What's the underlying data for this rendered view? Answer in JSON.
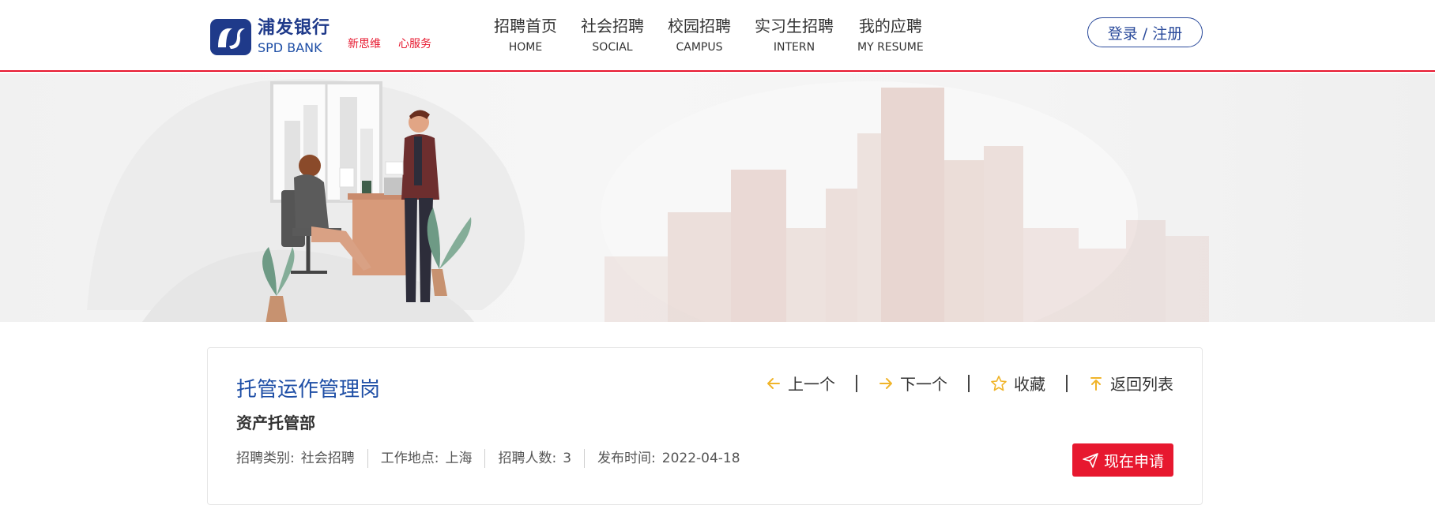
{
  "brand": {
    "name_cn": "浦发银行",
    "name_en": "SPD BANK",
    "slogans": [
      "新思维",
      "心服务"
    ]
  },
  "nav": [
    {
      "cn": "招聘首页",
      "en": "HOME"
    },
    {
      "cn": "社会招聘",
      "en": "SOCIAL"
    },
    {
      "cn": "校园招聘",
      "en": "CAMPUS"
    },
    {
      "cn": "实习生招聘",
      "en": "INTERN"
    },
    {
      "cn": "我的应聘",
      "en": "MY RESUME"
    }
  ],
  "login_label": "登录 / 注册",
  "job": {
    "title": "托管运作管理岗",
    "department": "资产托管部",
    "meta": [
      {
        "label": "招聘类别:",
        "value": "社会招聘"
      },
      {
        "label": "工作地点:",
        "value": "上海"
      },
      {
        "label": "招聘人数:",
        "value": "3"
      },
      {
        "label": "发布时间:",
        "value": "2022-04-18"
      }
    ],
    "apply_label": "现在申请"
  },
  "actions": {
    "prev": "上一个",
    "next": "下一个",
    "favorite": "收藏",
    "back": "返回列表"
  },
  "colors": {
    "brand_blue": "#1f4fa6",
    "accent_red": "#e7182f",
    "icon_gold": "#f0b429"
  }
}
